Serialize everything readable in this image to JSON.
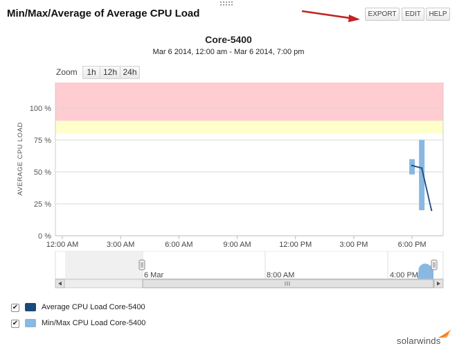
{
  "header": {
    "title": "Min/Max/Average of Average CPU Load",
    "buttons": {
      "export": "EXPORT",
      "edit": "EDIT",
      "help": "HELP"
    }
  },
  "chart_data": {
    "type": "line",
    "title": "Core-5400",
    "subtitle": "Mar 6 2014, 12:00 am - Mar 6 2014, 7:00 pm",
    "ylabel": "AVERAGE CPU LOAD",
    "xlabel": "",
    "ylim": [
      0,
      120
    ],
    "y_ticks": [
      {
        "value": 0,
        "label": "0 %"
      },
      {
        "value": 25,
        "label": "25 %"
      },
      {
        "value": 50,
        "label": "50 %"
      },
      {
        "value": 75,
        "label": "75 %"
      },
      {
        "value": 100,
        "label": "100 %"
      }
    ],
    "xlim_hours": [
      0,
      19.6
    ],
    "x_ticks": [
      {
        "value": 0,
        "label": "12:00 AM"
      },
      {
        "value": 3,
        "label": "3:00 AM"
      },
      {
        "value": 6,
        "label": "6:00 AM"
      },
      {
        "value": 9,
        "label": "9:00 AM"
      },
      {
        "value": 12,
        "label": "12:00 PM"
      },
      {
        "value": 15,
        "label": "3:00 PM"
      },
      {
        "value": 18,
        "label": "6:00 PM"
      }
    ],
    "threshold_bands": [
      {
        "from": 90,
        "to": 120,
        "color": "#ffccd1"
      },
      {
        "from": 80,
        "to": 90,
        "color": "#ffffcc"
      }
    ],
    "series": [
      {
        "name": "Average CPU Load Core-5400",
        "type": "line",
        "color": "#1a4a7a",
        "points": [
          {
            "x": 18.0,
            "y": 55
          },
          {
            "x": 18.5,
            "y": 53
          },
          {
            "x": 19.0,
            "y": 20
          }
        ]
      },
      {
        "name": "Min/Max CPU Load Core-5400",
        "type": "columnrange",
        "color": "#89b8e0",
        "ranges": [
          {
            "x": 18.0,
            "low": 48,
            "high": 60
          },
          {
            "x": 18.5,
            "low": 20,
            "high": 75
          }
        ]
      }
    ],
    "zoom": {
      "label": "Zoom",
      "options": [
        "1h",
        "12h",
        "24h"
      ]
    },
    "navigator": {
      "labels": [
        "6 Mar",
        "8:00 AM",
        "4:00 PM"
      ]
    },
    "legend_placement": "bottom-left"
  },
  "legend": {
    "items": [
      {
        "label": "Average CPU Load Core-5400",
        "color": "#1a4a7a",
        "checked": "✔"
      },
      {
        "label": "Min/Max CPU Load Core-5400",
        "color": "#89b8e0",
        "checked": "✔"
      }
    ]
  },
  "branding": {
    "text": "solarwinds",
    "accent_color": "#f47b20"
  }
}
